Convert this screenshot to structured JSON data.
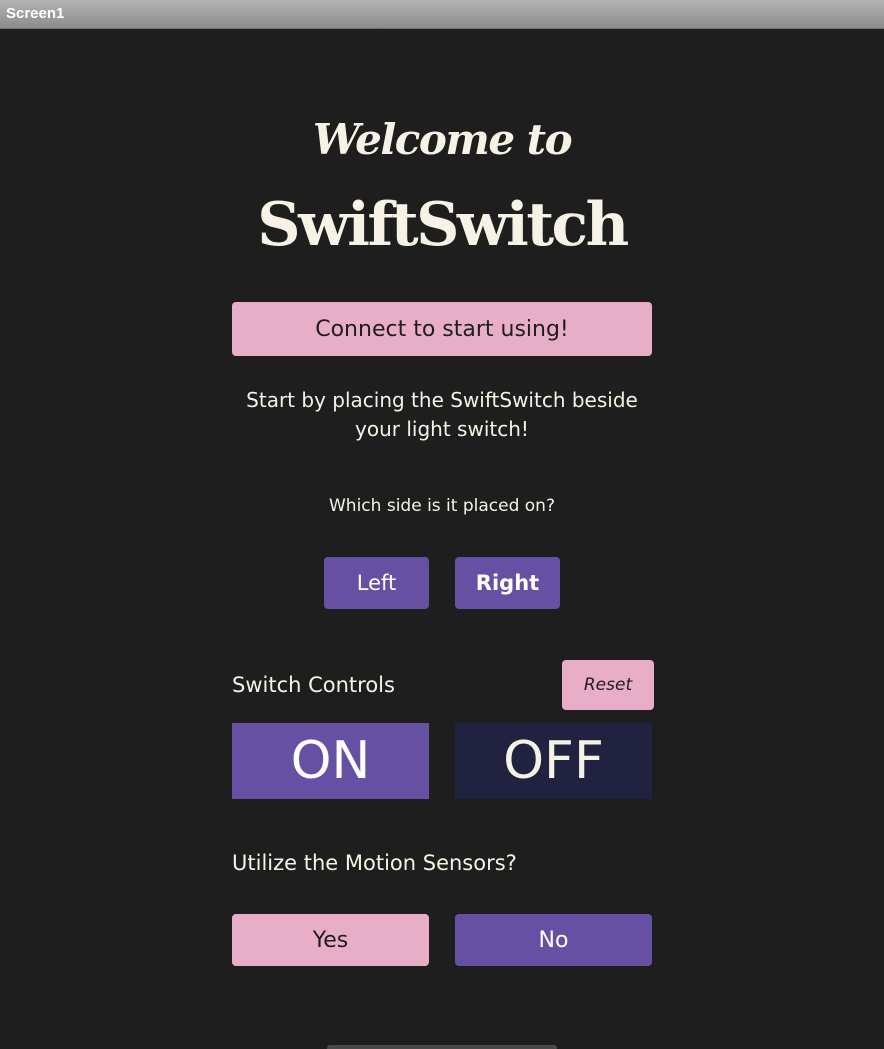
{
  "window": {
    "title": "Screen1"
  },
  "header": {
    "welcome": "Welcome to",
    "brand": "SwiftSwitch"
  },
  "connect": {
    "label": "Connect to start using!"
  },
  "instructions": {
    "line1": "Start by placing the SwiftSwitch beside",
    "line2": "your light switch!"
  },
  "side": {
    "question": "Which side is it placed on?",
    "left_label": "Left",
    "right_label": "Right"
  },
  "switch_controls": {
    "label": "Switch Controls",
    "reset_label": "Reset",
    "on_label": "ON",
    "off_label": "OFF"
  },
  "motion": {
    "question": "Utilize the Motion Sensors?",
    "yes_label": "Yes",
    "no_label": "No"
  },
  "colors": {
    "background": "#1e1e1e",
    "text": "#f7f2e6",
    "pink": "#e8aec8",
    "purple": "#6650a4",
    "navy": "#212240"
  }
}
